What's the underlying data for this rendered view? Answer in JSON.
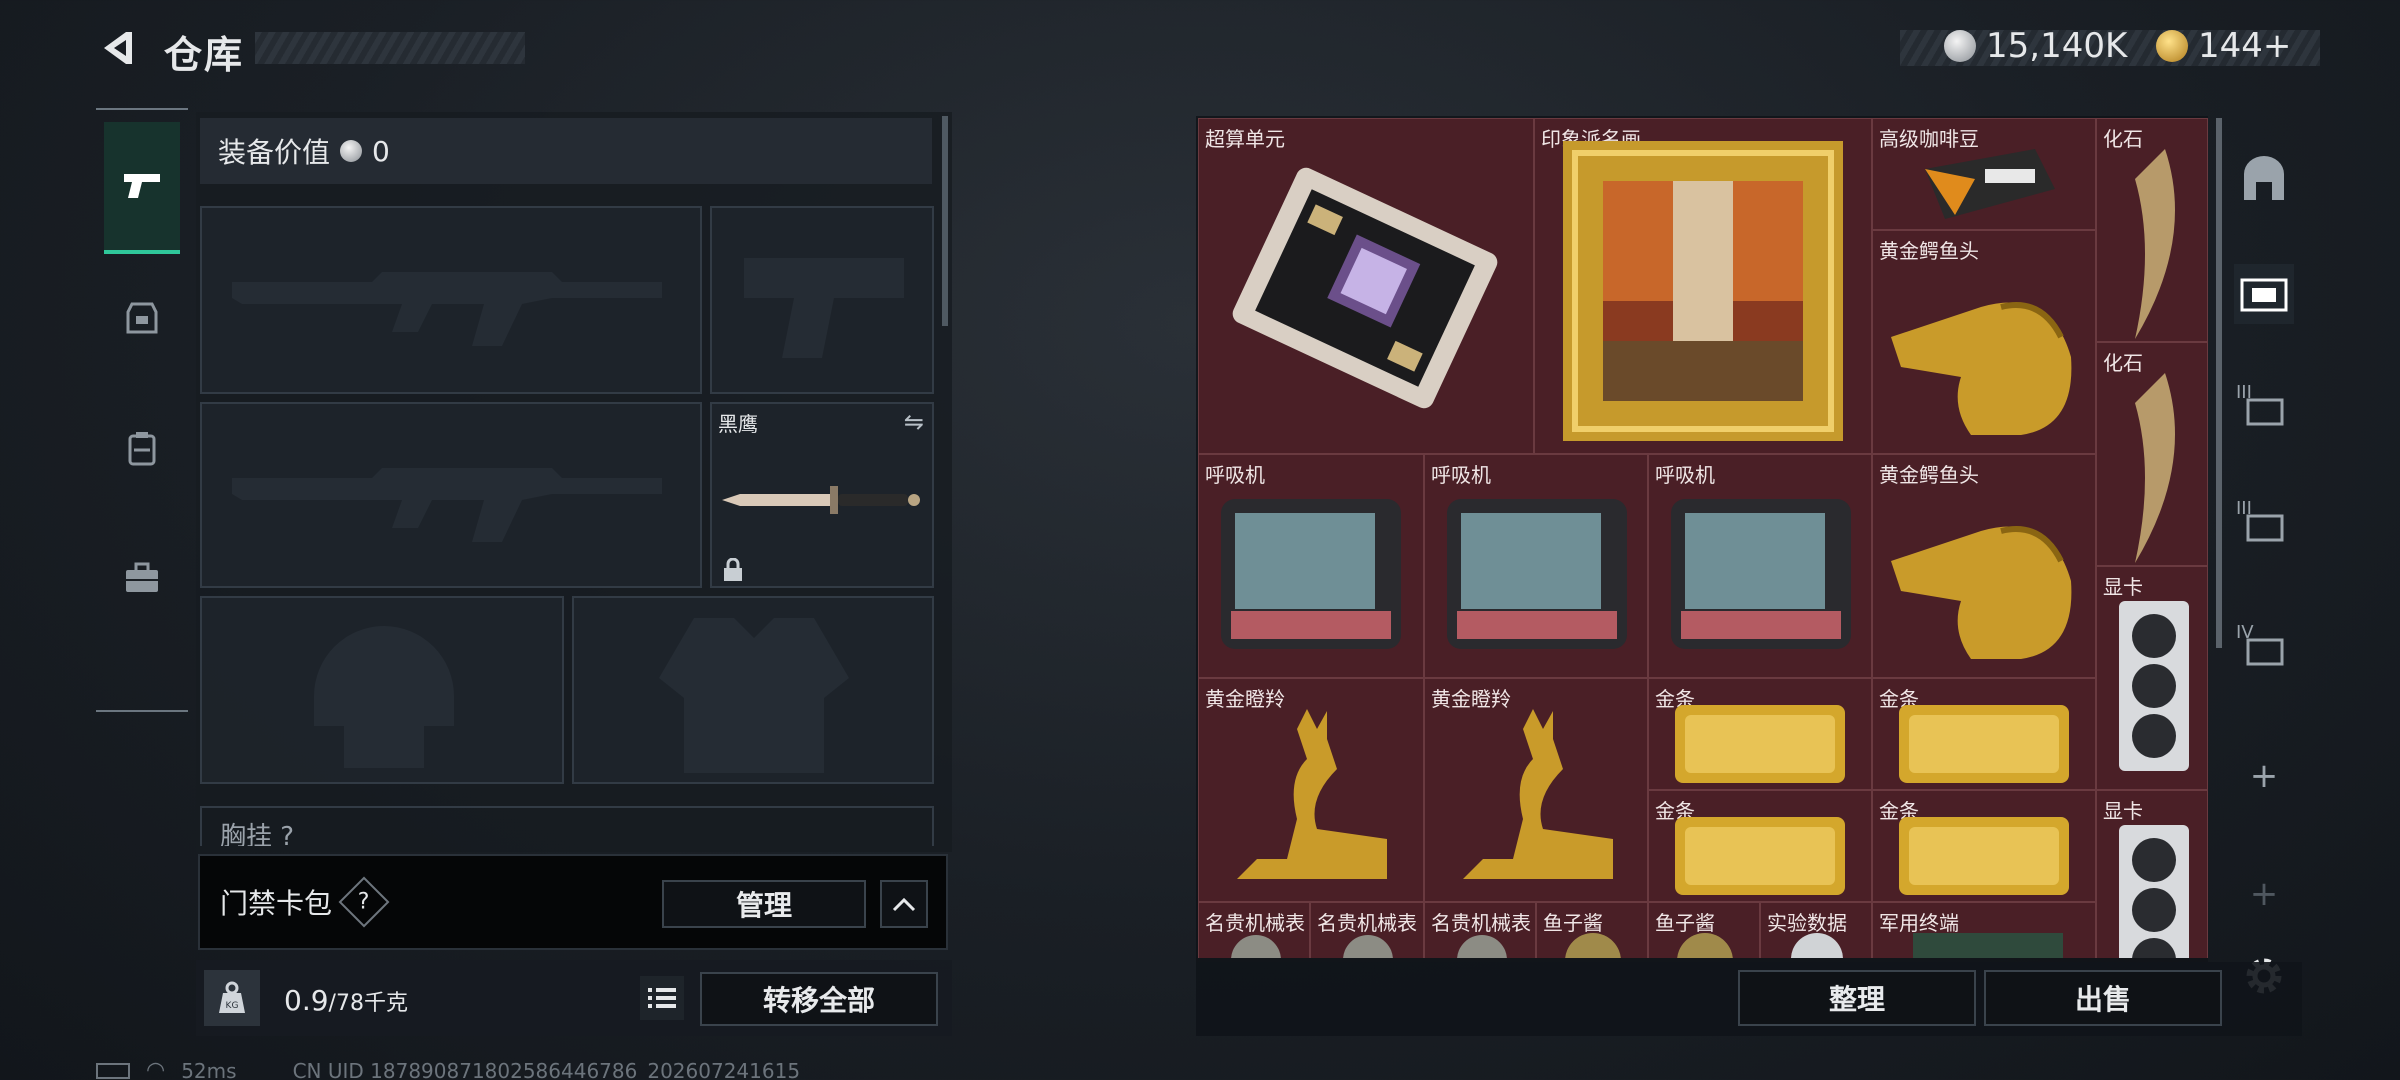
{
  "header": {
    "title": "仓库",
    "currency_1": "15,140K",
    "currency_2": "144+"
  },
  "left_tabs": [
    {
      "name": "weapons",
      "active": true
    },
    {
      "name": "gear"
    },
    {
      "name": "backpack"
    },
    {
      "name": "case"
    }
  ],
  "equipment": {
    "value_label": "装备价值",
    "value": "0",
    "knife_name": "黑鹰",
    "chest_label": "胸挂 ?"
  },
  "card_bar": {
    "label": "门禁卡包",
    "help": "?",
    "manage": "管理"
  },
  "weight": {
    "current": "0.9",
    "max": "/78千克",
    "transfer_all": "转移全部"
  },
  "storage": {
    "items": [
      {
        "label": "超算单元",
        "type": "chip"
      },
      {
        "label": "印象派名画",
        "type": "painting"
      },
      {
        "label": "高级咖啡豆",
        "type": "coffee"
      },
      {
        "label": "化石",
        "type": "fossil"
      },
      {
        "label": "黄金鳄鱼头",
        "type": "croc"
      },
      {
        "label": "化石",
        "type": "fossil"
      },
      {
        "label": "呼吸机",
        "type": "ventilator"
      },
      {
        "label": "呼吸机",
        "type": "ventilator"
      },
      {
        "label": "呼吸机",
        "type": "ventilator"
      },
      {
        "label": "黄金鳄鱼头",
        "type": "croc"
      },
      {
        "label": "显卡",
        "type": "gpu"
      },
      {
        "label": "黄金瞪羚",
        "type": "gazelle"
      },
      {
        "label": "黄金瞪羚",
        "type": "gazelle"
      },
      {
        "label": "金条",
        "type": "gold"
      },
      {
        "label": "金条",
        "type": "gold"
      },
      {
        "label": "金条",
        "type": "gold"
      },
      {
        "label": "金条",
        "type": "gold"
      },
      {
        "label": "显卡",
        "type": "gpu"
      },
      {
        "label": "名贵机械表",
        "type": "watch"
      },
      {
        "label": "名贵机械表",
        "type": "watch"
      },
      {
        "label": "名贵机械表",
        "type": "watch"
      },
      {
        "label": "鱼子酱",
        "type": "caviar"
      },
      {
        "label": "鱼子酱",
        "type": "caviar"
      },
      {
        "label": "实验数据",
        "type": "data"
      },
      {
        "label": "军用终端",
        "type": "terminal"
      }
    ],
    "sort": "整理",
    "sell": "出售"
  },
  "side_tabs": [
    "home",
    "stash-1",
    "stash-III-a",
    "stash-III-b",
    "stash-IV",
    "add",
    "add-disabled"
  ],
  "side_tab_labels": {
    "t3a": "III",
    "t3b": "III",
    "t4": "IV",
    "add": "+",
    "add2": "+"
  },
  "status": {
    "ping": "52ms",
    "uid": "CN UID 1878908718025864467​86_202607241615"
  },
  "colors": {
    "accent": "#2fc79a",
    "cell_bg": "#4a1f26",
    "gold": "#d4a72c"
  }
}
